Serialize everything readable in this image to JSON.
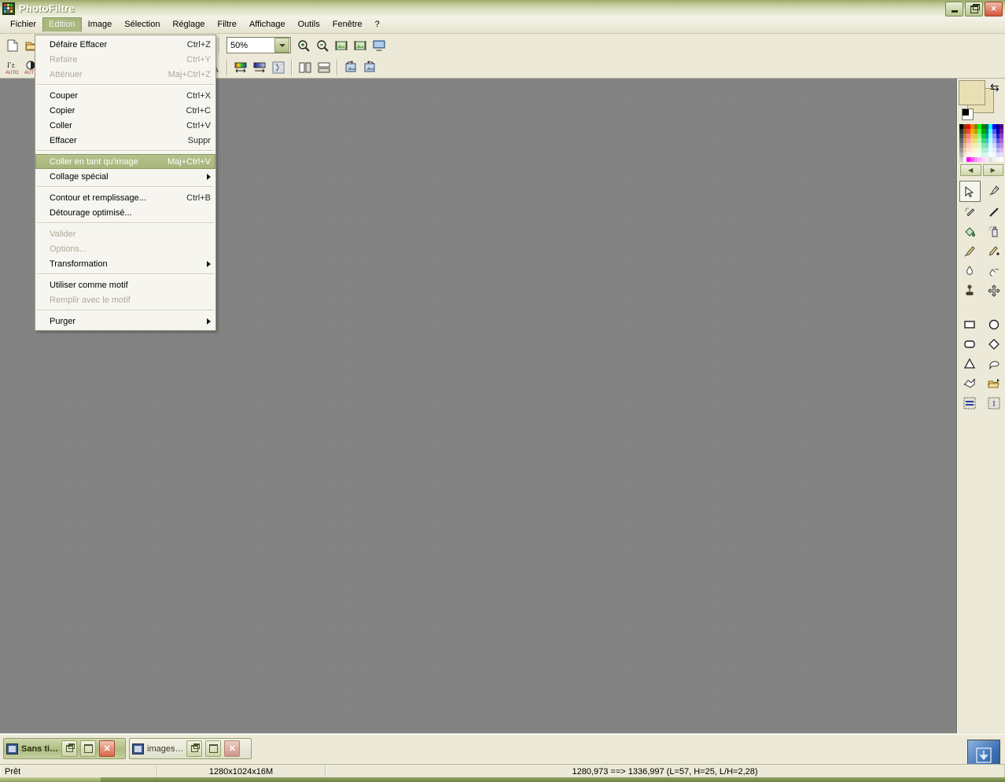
{
  "window": {
    "title": "PhotoFiltre",
    "icon": "photofiltre-app-icon",
    "controls": {
      "minimize": "minimize-button",
      "restore": "restore-button",
      "close_label": "✕"
    }
  },
  "menubar": {
    "items": [
      {
        "label": "Fichier",
        "active": false
      },
      {
        "label": "Edition",
        "active": true
      },
      {
        "label": "Image",
        "active": false
      },
      {
        "label": "Sélection",
        "active": false
      },
      {
        "label": "Réglage",
        "active": false
      },
      {
        "label": "Filtre",
        "active": false
      },
      {
        "label": "Affichage",
        "active": false
      },
      {
        "label": "Outils",
        "active": false
      },
      {
        "label": "Fenêtre",
        "active": false
      },
      {
        "label": "?",
        "active": false
      }
    ]
  },
  "dropdown": {
    "owner": "Edition",
    "items": [
      {
        "kind": "item",
        "label": "Défaire Effacer",
        "accel": "Ctrl+Z",
        "disabled": false,
        "highlight": false,
        "submenu": false
      },
      {
        "kind": "item",
        "label": "Refaire",
        "accel": "Ctrl+Y",
        "disabled": true,
        "highlight": false,
        "submenu": false
      },
      {
        "kind": "item",
        "label": "Atténuer",
        "accel": "Maj+Ctrl+Z",
        "disabled": true,
        "highlight": false,
        "submenu": false
      },
      {
        "kind": "sep"
      },
      {
        "kind": "item",
        "label": "Couper",
        "accel": "Ctrl+X",
        "disabled": false,
        "highlight": false,
        "submenu": false
      },
      {
        "kind": "item",
        "label": "Copier",
        "accel": "Ctrl+C",
        "disabled": false,
        "highlight": false,
        "submenu": false
      },
      {
        "kind": "item",
        "label": "Coller",
        "accel": "Ctrl+V",
        "disabled": false,
        "highlight": false,
        "submenu": false
      },
      {
        "kind": "item",
        "label": "Effacer",
        "accel": "Suppr",
        "disabled": false,
        "highlight": false,
        "submenu": false
      },
      {
        "kind": "sep"
      },
      {
        "kind": "item",
        "label": "Coller en tant qu'image",
        "accel": "Maj+Ctrl+V",
        "disabled": false,
        "highlight": true,
        "submenu": false
      },
      {
        "kind": "item",
        "label": "Collage spécial",
        "accel": "",
        "disabled": false,
        "highlight": false,
        "submenu": true
      },
      {
        "kind": "sep"
      },
      {
        "kind": "item",
        "label": "Contour et remplissage...",
        "accel": "Ctrl+B",
        "disabled": false,
        "highlight": false,
        "submenu": false
      },
      {
        "kind": "item",
        "label": "Détourage optimisé...",
        "accel": "",
        "disabled": false,
        "highlight": false,
        "submenu": false
      },
      {
        "kind": "sep"
      },
      {
        "kind": "item",
        "label": "Valider",
        "accel": "",
        "disabled": true,
        "highlight": false,
        "submenu": false
      },
      {
        "kind": "item",
        "label": "Options...",
        "accel": "",
        "disabled": true,
        "highlight": false,
        "submenu": false
      },
      {
        "kind": "item",
        "label": "Transformation",
        "accel": "",
        "disabled": false,
        "highlight": false,
        "submenu": true
      },
      {
        "kind": "sep"
      },
      {
        "kind": "item",
        "label": "Utiliser comme motif",
        "accel": "",
        "disabled": false,
        "highlight": false,
        "submenu": false
      },
      {
        "kind": "item",
        "label": "Remplir avec le motif",
        "accel": "",
        "disabled": true,
        "highlight": false,
        "submenu": false
      },
      {
        "kind": "sep"
      },
      {
        "kind": "item",
        "label": "Purger",
        "accel": "",
        "disabled": false,
        "highlight": false,
        "submenu": true
      }
    ]
  },
  "toolbar_top": {
    "zoom_value": "50%",
    "buttons": [
      {
        "icon": "new-document-icon"
      },
      {
        "icon": "open-folder-icon"
      },
      {
        "sep": true
      },
      {
        "icon": "color-bars-icon"
      },
      {
        "icon": "transparency-icon"
      },
      {
        "sep": true
      },
      {
        "icon": "copy-image-icon"
      },
      {
        "icon": "paste-image-icon"
      },
      {
        "icon": "text-tool-icon"
      },
      {
        "sep": true
      },
      {
        "icon": "layers-icon"
      },
      {
        "icon": "palette-icon"
      },
      {
        "icon": "window-properties-icon"
      },
      {
        "sep": true
      },
      {
        "icon": "zoom-combo"
      },
      {
        "icon": "zoom-in-icon"
      },
      {
        "icon": "zoom-out-icon"
      },
      {
        "icon": "fit-image-icon"
      },
      {
        "icon": "actual-size-icon"
      },
      {
        "icon": "fullscreen-icon"
      }
    ]
  },
  "toolbar_second": {
    "buttons": [
      {
        "icon": "auto-levels-icon"
      },
      {
        "icon": "auto-contrast-icon"
      },
      {
        "sep": true
      },
      {
        "icon": "gamma-plus-icon"
      },
      {
        "sep": true
      },
      {
        "icon": "grayscale-grid-icon"
      },
      {
        "icon": "color-grid-icon"
      },
      {
        "sep": true
      },
      {
        "icon": "halftone-icon"
      },
      {
        "icon": "blur-drop-icon"
      },
      {
        "icon": "blur-more-icon"
      },
      {
        "sep": true
      },
      {
        "icon": "sharpen-icon"
      },
      {
        "icon": "sharpen-more-icon"
      },
      {
        "sep": true
      },
      {
        "icon": "gradient-icon"
      },
      {
        "icon": "gradient-blue-icon"
      },
      {
        "icon": "transparency-mask-icon"
      },
      {
        "sep": true
      },
      {
        "icon": "flip-horizontal-icon"
      },
      {
        "icon": "flip-vertical-icon"
      },
      {
        "sep": true
      },
      {
        "icon": "rotate-left-icon"
      },
      {
        "icon": "rotate-right-icon"
      }
    ]
  },
  "rightdock": {
    "swatches": {
      "foreground": "#e8dfb4",
      "background": "#e8dfb4",
      "reset_icon": "reset-colors-icon",
      "swap_icon": "swap-colors-icon"
    },
    "palette_nav": {
      "prev": "◀",
      "next": "▶"
    },
    "palette_colors": [
      "#000000",
      "#7f3f00",
      "#ff0000",
      "#ff7f00",
      "#7f7f00",
      "#00ff00",
      "#007f00",
      "#005f5f",
      "#00ffff",
      "#0000ff",
      "#00007f",
      "#4b0082",
      "#323232",
      "#9f5a00",
      "#ff3f3f",
      "#ffaa00",
      "#aaaa00",
      "#55ff55",
      "#00aa00",
      "#008080",
      "#55ffff",
      "#5555ff",
      "#0000aa",
      "#6a1fa0",
      "#4c4c4c",
      "#bf7f3f",
      "#ff7f7f",
      "#ffbf55",
      "#cfcf3f",
      "#8cff8c",
      "#00cc44",
      "#00a0a0",
      "#8cffff",
      "#8c8cff",
      "#2222cc",
      "#8c3fc0",
      "#666666",
      "#d89a5a",
      "#ffa5a5",
      "#ffd27f",
      "#e2e27f",
      "#b5ffb5",
      "#3fd97f",
      "#3fc3c3",
      "#b5ffff",
      "#b5b5ff",
      "#5555dd",
      "#a565d0",
      "#7f7f7f",
      "#e8b57f",
      "#ffc8c8",
      "#ffe2aa",
      "#f0f0aa",
      "#d2ffd2",
      "#7fe8aa",
      "#7fd9d9",
      "#d2ffff",
      "#d2d2ff",
      "#8888ee",
      "#c28ce0",
      "#999999",
      "#f0cfa5",
      "#ffdede",
      "#fff0cf",
      "#f8f8cf",
      "#e8ffe8",
      "#aff0cf",
      "#aee9e9",
      "#e8ffff",
      "#e8e8ff",
      "#b0b0f5",
      "#dcb5f0",
      "#b2b2b2",
      "#f7e2c8",
      "#fff0f0",
      "#fff8e8",
      "#fcfce8",
      "#f4fff4",
      "#d5f8e8",
      "#d6f4f4",
      "#f4ffff",
      "#f4f4ff",
      "#d8d8fa",
      "#eddaf8",
      "#cccccc",
      "#ffffff",
      "#ff00ff",
      "#ff55ff",
      "#ff8cff",
      "#ffb5ff",
      "#ffd2ff",
      "#ffe8ff",
      "#e0e0e0",
      "#f0f0f0",
      "#f8f8f8",
      "#ffffff"
    ],
    "tools": [
      {
        "icon": "selection-arrow-icon",
        "selected": true
      },
      {
        "icon": "eyedropper-icon",
        "selected": false
      },
      {
        "icon": "magic-wand-icon",
        "selected": false
      },
      {
        "icon": "line-tool-icon",
        "selected": false
      },
      {
        "icon": "paint-bucket-icon",
        "selected": false
      },
      {
        "icon": "spray-can-icon",
        "selected": false
      },
      {
        "icon": "paintbrush-icon",
        "selected": false
      },
      {
        "icon": "paintbrush-advanced-icon",
        "selected": false
      },
      {
        "icon": "blur-drop-tool-icon",
        "selected": false
      },
      {
        "icon": "smudge-tool-icon",
        "selected": false
      },
      {
        "icon": "clone-stamp-icon",
        "selected": false
      },
      {
        "icon": "move-tool-icon",
        "selected": false
      }
    ],
    "shapes": [
      {
        "icon": "rectangle-shape-icon"
      },
      {
        "icon": "ellipse-shape-icon"
      },
      {
        "icon": "rounded-rectangle-shape-icon"
      },
      {
        "icon": "diamond-shape-icon"
      },
      {
        "icon": "triangle-shape-icon"
      },
      {
        "icon": "freehand-shape-icon"
      },
      {
        "icon": "polygon-shape-icon"
      },
      {
        "icon": "open-shape-folder-icon"
      },
      {
        "icon": "horizontal-align-icon"
      },
      {
        "icon": "vertical-text-icon"
      }
    ]
  },
  "mdi_taskbar": {
    "windows": [
      {
        "label": "Sans ti…",
        "active": true,
        "icon": "image-window-icon"
      },
      {
        "label": "images…",
        "active": false,
        "icon": "image-window-icon"
      }
    ],
    "controls": {
      "restore": "restore",
      "maximize": "maximize",
      "close": "✕"
    },
    "navigator_icon": "navigator-down-arrow-icon"
  },
  "statusbar": {
    "ready": "Prêt",
    "image_info": "1280x1024x16M",
    "coordinates": "1280,973 ==> 1336,997 (L=57, H=25, L/H=2,28)"
  }
}
